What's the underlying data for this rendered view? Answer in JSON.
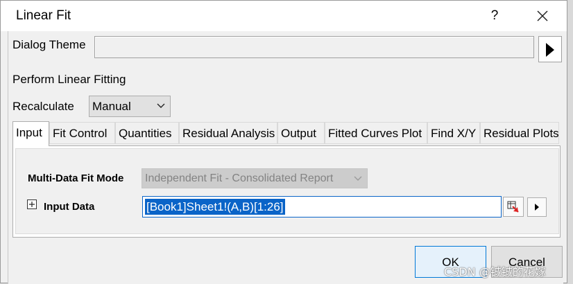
{
  "window": {
    "title": "Linear Fit",
    "help_label": "?",
    "close_icon": "close-icon"
  },
  "theme": {
    "label": "Dialog Theme",
    "value": "",
    "arrow_icon": "triangle-right-icon"
  },
  "perform_label": "Perform Linear Fitting",
  "recalculate": {
    "label": "Recalculate",
    "value": "Manual"
  },
  "tabs": [
    {
      "label": "Input",
      "active": true
    },
    {
      "label": "Fit Control",
      "active": false
    },
    {
      "label": "Quantities",
      "active": false
    },
    {
      "label": "Residual Analysis",
      "active": false
    },
    {
      "label": "Output",
      "active": false
    },
    {
      "label": "Fitted Curves Plot",
      "active": false
    },
    {
      "label": "Find X/Y",
      "active": false
    },
    {
      "label": "Residual Plots",
      "active": false
    }
  ],
  "input_tab": {
    "mode_label": "Multi-Data Fit Mode",
    "mode_value": "Independent Fit - Consolidated Report",
    "data_label": "Input Data",
    "data_value": "[Book1]Sheet1!(A,B)[1:26]"
  },
  "buttons": {
    "ok": "OK",
    "cancel": "Cancel"
  },
  "watermark": "CSDN @铖铖的花嫁",
  "colors": {
    "selection": "#0a64c8",
    "ok_border": "#0078d7"
  }
}
